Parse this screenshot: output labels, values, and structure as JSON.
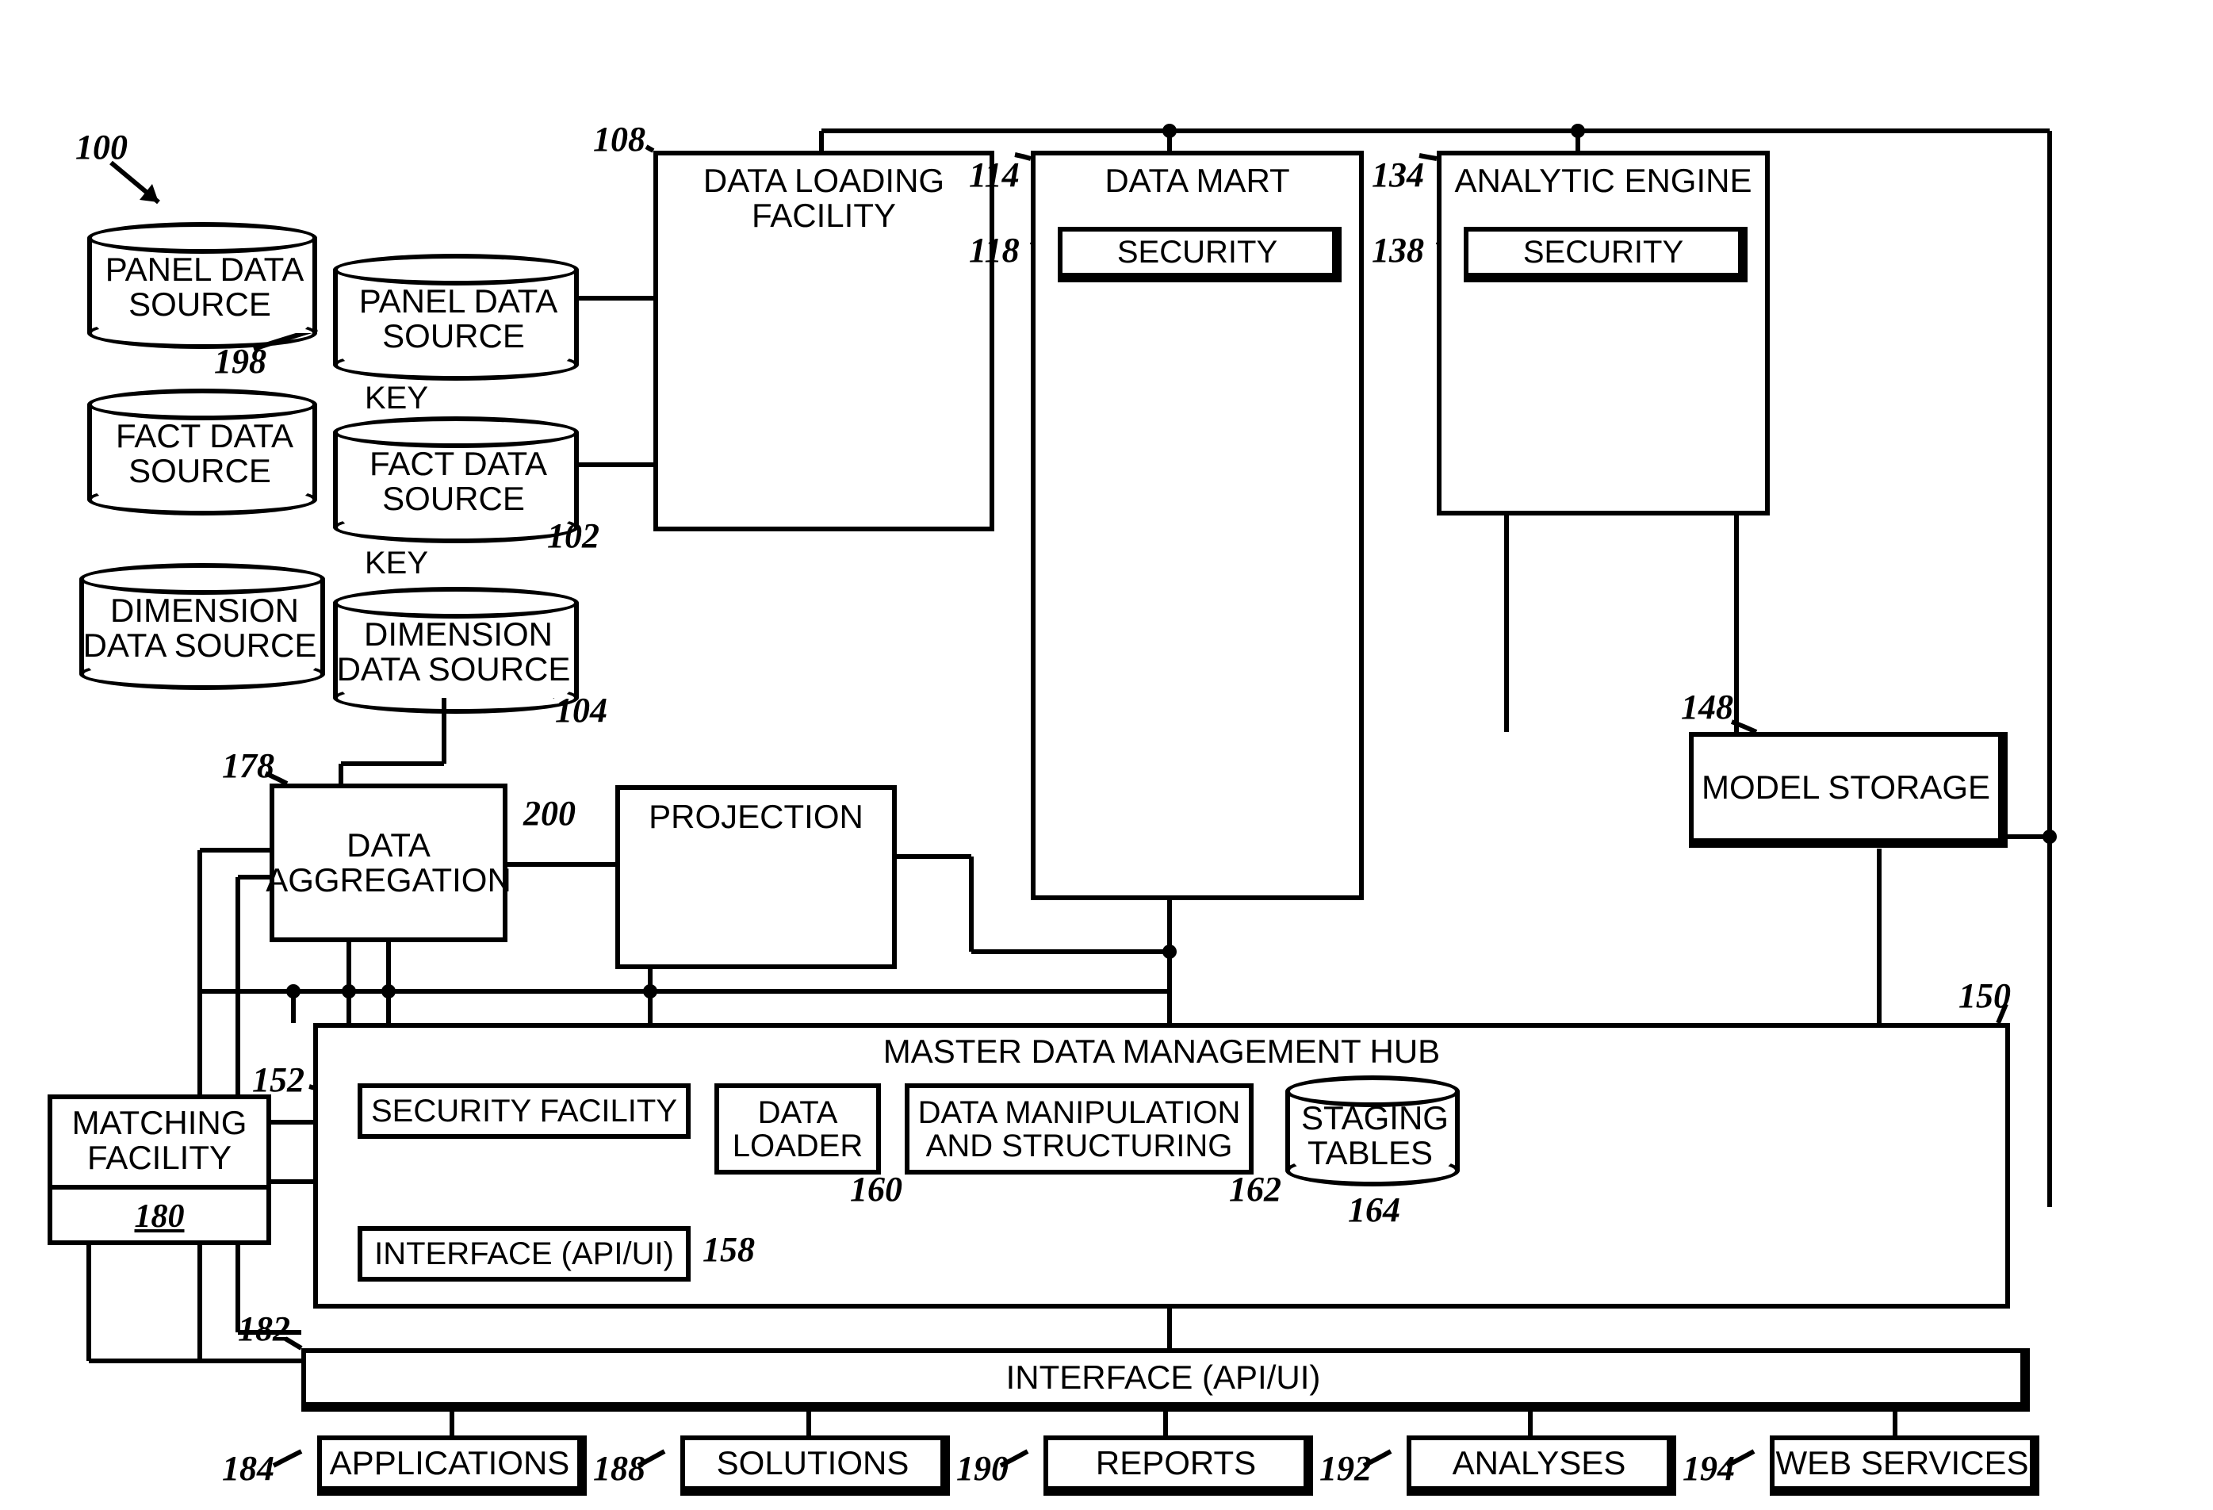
{
  "refs": {
    "r100": "100",
    "r108": "108",
    "r114": "114",
    "r118": "118",
    "r134": "134",
    "r138": "138",
    "r198": "198",
    "r102": "102",
    "r104": "104",
    "r178": "178",
    "r200": "200",
    "r148": "148",
    "r150": "150",
    "r152": "152",
    "r160": "160",
    "r162": "162",
    "r164": "164",
    "r158": "158",
    "r180": "180",
    "r182": "182",
    "r184": "184",
    "r188": "188",
    "r190": "190",
    "r192": "192",
    "r194": "194"
  },
  "keys": {
    "k1": "KEY",
    "k2": "KEY"
  },
  "boxes": {
    "data_loading": "DATA LOADING\nFACILITY",
    "data_mart": "DATA MART",
    "dm_security": "SECURITY",
    "analytic_engine": "ANALYTIC ENGINE",
    "ae_security": "SECURITY",
    "data_aggregation": "DATA\nAGGREGATION",
    "projection": "PROJECTION",
    "model_storage": "MODEL STORAGE",
    "mdm_hub": "MASTER DATA MANAGEMENT HUB",
    "security_facility": "SECURITY FACILITY",
    "data_loader": "DATA\nLOADER",
    "data_manip": "DATA MANIPULATION\nAND STRUCTURING",
    "staging_tables": "STAGING\nTABLES",
    "interface_api_ui_inner": "INTERFACE (API/UI)",
    "matching_facility": "MATCHING\nFACILITY",
    "matching_180": "180",
    "interface_bar": "INTERFACE (API/UI)",
    "applications": "APPLICATIONS",
    "solutions": "SOLUTIONS",
    "reports": "REPORTS",
    "analyses": "ANALYSES",
    "web_services": "WEB SERVICES"
  },
  "cyls": {
    "panel1": "PANEL DATA\nSOURCE",
    "panel2": "PANEL DATA\nSOURCE",
    "fact1": "FACT DATA\nSOURCE",
    "fact2": "FACT DATA\nSOURCE",
    "dim1": "DIMENSION\nDATA SOURCE",
    "dim2": "DIMENSION\nDATA SOURCE"
  }
}
